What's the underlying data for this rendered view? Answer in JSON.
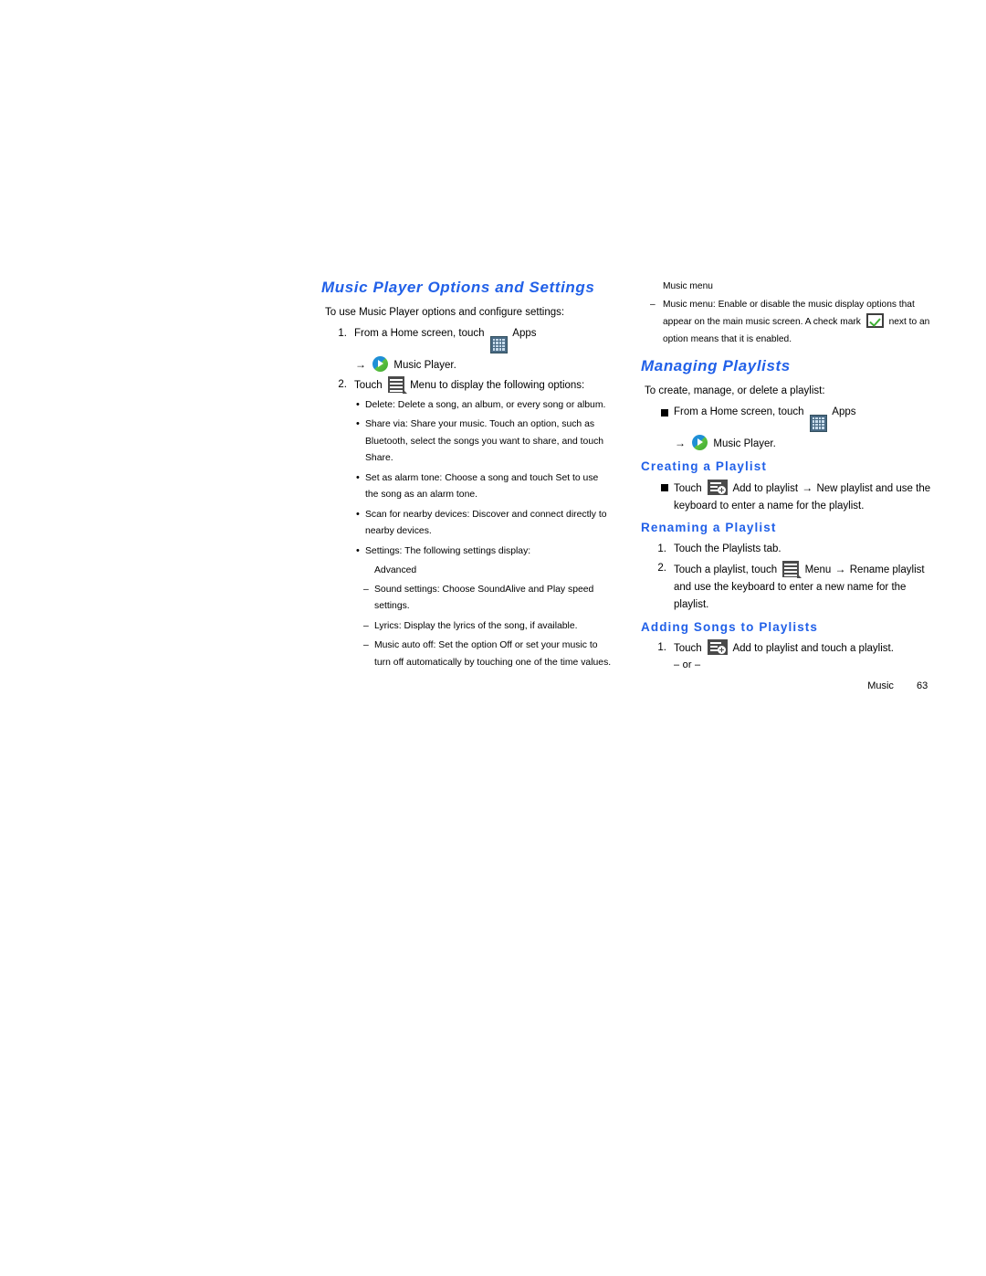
{
  "document": {
    "footer": {
      "section": "Music",
      "page": "63"
    },
    "accent_color": "#2160e8"
  },
  "left_column": {
    "heading": "Music Player Options and Settings",
    "lead": "To use Music Player options and configure settings:",
    "step1": {
      "num": "1.",
      "text_before_icon": "From a Home screen, touch",
      "apps_label": "Apps",
      "cont_label": "Music Player."
    },
    "step2": {
      "num": "2.",
      "text_before_icon": "Touch",
      "text_after_icon": "Menu to display the following options:"
    },
    "bullets": [
      "Delete: Delete a song, an album, or every song or album.",
      "Share via: Share your music. Touch an option, such as Bluetooth, select the songs you want to share, and touch Share.",
      "Set as alarm tone: Choose a song and touch Set to use the song as an alarm tone.",
      "Scan for nearby devices: Discover and connect directly to nearby devices.",
      "Settings: The following settings display:"
    ],
    "settings_group_label": "Advanced",
    "settings_items": [
      "Sound settings: Choose SoundAlive and Play speed settings.",
      "Lyrics: Display the lyrics of the song, if available.",
      "Music auto off: Set the option Off or set your music to turn off automatically by touching one of the time values."
    ]
  },
  "right_column": {
    "music_menu_group_label": "Music menu",
    "music_menu_text_1": "Music menu: Enable or disable the music display options that appear on the main music screen. A check mark",
    "music_menu_text_2": "next to an option means that it is enabled.",
    "managing_playlists": {
      "heading": "Managing Playlists",
      "lead": "To create, manage, or delete a playlist:",
      "step": {
        "text_before_icon": "From a Home screen, touch",
        "apps_label": "Apps",
        "cont_label": "Music Player."
      }
    },
    "creating_playlist": {
      "heading": "Creating a Playlist",
      "text_before_icon": "Touch",
      "text_after_icon": "Add to playlist",
      "text_after_arrow": "New playlist and use the keyboard to enter a name for the playlist."
    },
    "renaming_playlist": {
      "heading": "Renaming a Playlist",
      "step1": {
        "num": "1.",
        "text": "Touch the Playlists tab."
      },
      "step2": {
        "num": "2.",
        "text_before_icon": "Touch a playlist, touch",
        "text_after_icon": "Menu",
        "text_after_arrow": "Rename playlist and use the keyboard to enter a new name for the playlist."
      }
    },
    "adding_songs": {
      "heading": "Adding Songs to Playlists",
      "step1": {
        "num": "1.",
        "text_before_icon": "Touch",
        "text_after_icon": "Add to playlist and touch a playlist."
      },
      "or_text": "– or –"
    }
  },
  "icons": {
    "apps": "apps-grid-icon",
    "music_player": "music-player-icon",
    "menu": "menu-icon",
    "add_to_playlist": "add-to-playlist-icon",
    "check_mark": "check-mark-icon",
    "arrow": "→"
  }
}
